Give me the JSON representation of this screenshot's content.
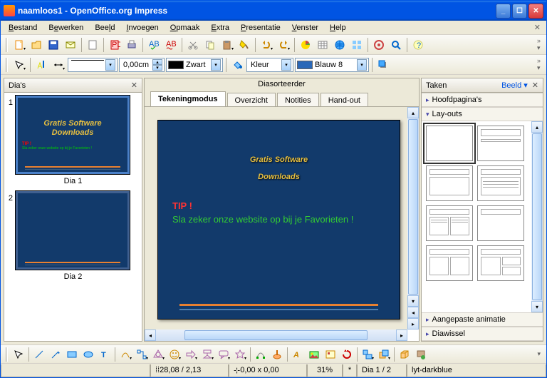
{
  "title": "naamloos1 - OpenOffice.org Impress",
  "menu": [
    "Bestand",
    "Bewerken",
    "Beeld",
    "Invoegen",
    "Opmaak",
    "Extra",
    "Presentatie",
    "Venster",
    "Help"
  ],
  "menu_accel": [
    0,
    1,
    3,
    0,
    0,
    0,
    0,
    0,
    0
  ],
  "toolbar2": {
    "width": "0,00cm",
    "color_name": "Zwart",
    "fill_label": "Kleur",
    "fill_color": "Blauw 8"
  },
  "slides_panel": {
    "title": "Dia's",
    "items": [
      {
        "num": "1",
        "label": "Dia 1"
      },
      {
        "num": "2",
        "label": "Dia 2"
      }
    ]
  },
  "tabs_top": "Diasorteerder",
  "tabs": [
    "Tekeningmodus",
    "Overzicht",
    "Notities",
    "Hand-out"
  ],
  "active_tab": 0,
  "slide": {
    "title_l1": "Gratis Software",
    "title_l2": "Downloads",
    "tip_label": "TIP !",
    "tip_text": "Sla zeker onze website op bij je Favorieten !"
  },
  "tasks": {
    "title": "Taken",
    "view_label": "Beeld",
    "sections": [
      "Hoofdpagina's",
      "Lay-outs",
      "Aangepaste animatie",
      "Diawissel"
    ]
  },
  "status": {
    "pos": "28,08 / 2,13",
    "size": "0,00 x 0,00",
    "zoom": "31%",
    "mark": "*",
    "slide": "Dia 1 / 2",
    "layout": "lyt-darkblue"
  }
}
